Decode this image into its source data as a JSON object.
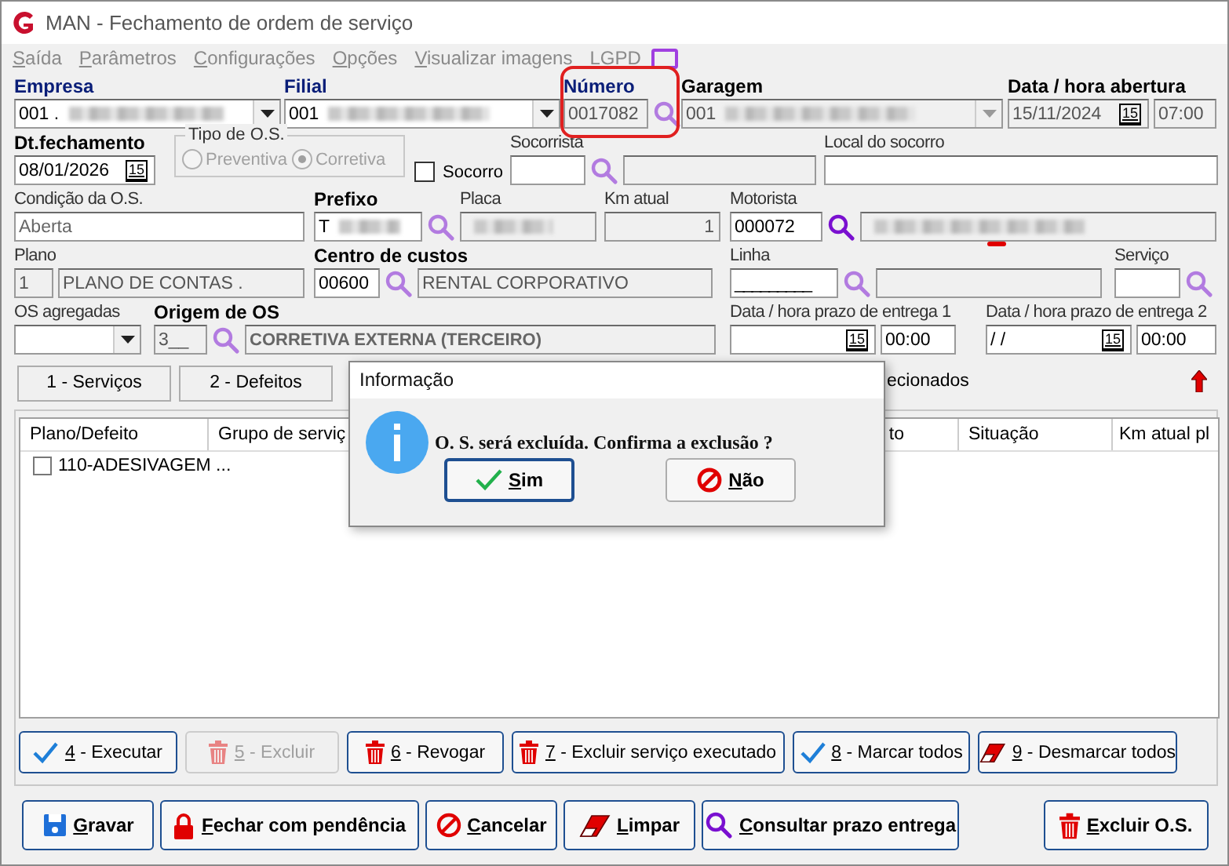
{
  "window": {
    "title": "MAN - Fechamento de ordem de serviço"
  },
  "menu": [
    {
      "label": "Saída"
    },
    {
      "label": "Parâmetros"
    },
    {
      "label": "Configurações"
    },
    {
      "label": "Opções"
    },
    {
      "label": "Visualizar imagens"
    },
    {
      "label": "LGPD"
    }
  ],
  "rows": [
    [
      {
        "label": "Empresa",
        "controls": [
          {
            "kind": "combo",
            "value": "001 .",
            "blurred": true,
            "readonly": false
          }
        ]
      },
      {
        "label": "Filial",
        "controls": [
          {
            "kind": "combo",
            "value": "001",
            "blurred": true,
            "readonly": false
          }
        ]
      },
      {
        "label": "Número",
        "controls": [
          {
            "kind": "text",
            "value": "0017082",
            "readonly": true
          },
          {
            "kind": "search",
            "emphasized": false
          }
        ]
      },
      {
        "label": "Garagem",
        "controls": [
          {
            "kind": "combo",
            "value": "001",
            "blurred": true,
            "readonly": true
          }
        ]
      },
      {
        "label": "Data / hora abertura",
        "controls": [
          {
            "kind": "date",
            "value": "15/11/2024",
            "icon_text": "15",
            "readonly": true
          },
          {
            "kind": "text",
            "value": "07:00",
            "readonly": true
          }
        ]
      }
    ],
    [
      {
        "label": "Dt.fechamento",
        "controls": [
          {
            "kind": "date",
            "value": "08/01/2026",
            "icon_text": "15",
            "readonly": false
          }
        ]
      },
      {
        "kind": "radio-group",
        "label": "Tipo de O.S.",
        "disabled": true,
        "options": [
          {
            "label": "Preventiva",
            "selected": false
          },
          {
            "label": "Corretiva",
            "selected": true
          }
        ]
      },
      {
        "kind": "checkbox",
        "label": "Socorro",
        "checked": false
      },
      {
        "label": "Socorrista",
        "controls": [
          {
            "kind": "text",
            "readonly": false
          },
          {
            "kind": "search",
            "emphasized": false
          },
          {
            "kind": "text",
            "readonly": true
          }
        ]
      },
      {
        "label": "Local do socorro",
        "controls": [
          {
            "kind": "text",
            "readonly": false
          }
        ]
      }
    ],
    [
      {
        "label": "Condição da O.S.",
        "controls": [
          {
            "kind": "text",
            "value": "Aberta",
            "readonly": false
          }
        ]
      },
      {
        "label": "Prefixo",
        "controls": [
          {
            "kind": "text",
            "value": "T",
            "blurred": true,
            "readonly": false
          },
          {
            "kind": "search",
            "emphasized": false
          }
        ]
      },
      {
        "label": "Placa",
        "controls": [
          {
            "kind": "text",
            "blurred": true,
            "readonly": true
          }
        ]
      },
      {
        "label": "Km atual",
        "controls": [
          {
            "kind": "number",
            "value": "1",
            "readonly": true
          }
        ]
      },
      {
        "label": "Motorista",
        "controls": [
          {
            "kind": "text",
            "value": "000072",
            "readonly": false
          },
          {
            "kind": "search",
            "emphasized": true
          },
          {
            "kind": "text",
            "blurred": true,
            "readonly": true
          }
        ]
      }
    ],
    [
      {
        "label": "Plano",
        "controls": [
          {
            "kind": "text",
            "value": "1",
            "readonly": true
          },
          {
            "kind": "text",
            "value": "PLANO DE CONTAS .",
            "readonly": true
          }
        ]
      },
      {
        "label": "Centro de custos",
        "controls": [
          {
            "kind": "text",
            "value": "00600",
            "readonly": false
          },
          {
            "kind": "search",
            "emphasized": false
          },
          {
            "kind": "text",
            "value": "RENTAL CORPORATIVO",
            "readonly": true
          }
        ]
      },
      {
        "label": "Linha",
        "controls": [
          {
            "kind": "text",
            "value": "_________",
            "readonly": false
          },
          {
            "kind": "search",
            "emphasized": false
          },
          {
            "kind": "text",
            "readonly": true
          }
        ]
      },
      {
        "label": "Serviço",
        "controls": [
          {
            "kind": "text",
            "readonly": false
          },
          {
            "kind": "search",
            "emphasized": false
          }
        ]
      }
    ],
    [
      {
        "label": "OS agregadas",
        "controls": [
          {
            "kind": "combo",
            "readonly": false
          }
        ]
      },
      {
        "label": "Origem de OS",
        "controls": [
          {
            "kind": "text",
            "value": "3__",
            "readonly": true
          },
          {
            "kind": "search",
            "emphasized": false
          },
          {
            "kind": "text",
            "value": "CORRETIVA EXTERNA (TERCEIRO)",
            "readonly": true
          }
        ]
      },
      {
        "label": "Data / hora prazo de entrega 1",
        "controls": [
          {
            "kind": "date",
            "icon_text": "15",
            "readonly": false
          },
          {
            "kind": "text",
            "value": "00:00",
            "readonly": false
          }
        ]
      },
      {
        "label": "Data / hora prazo de entrega 2",
        "controls": [
          {
            "kind": "date",
            "value": "/  /",
            "icon_text": "15",
            "readonly": false
          },
          {
            "kind": "text",
            "value": "00:00",
            "readonly": false
          }
        ]
      }
    ]
  ],
  "section_buttons": [
    {
      "label": "1 - Serviços"
    },
    {
      "label": "2 - Defeitos"
    }
  ],
  "selected_note": "ecionados",
  "table": {
    "columns": [
      "Plano/Defeito",
      "Grupo de serviç",
      "to",
      "Situação",
      "Km atual pl"
    ],
    "rows": [
      {
        "checked": false,
        "cells": [
          "110-ADESIVAGEM ..."
        ]
      }
    ]
  },
  "action_buttons": [
    {
      "label": "4 - Executar",
      "kind": "check",
      "disabled": false
    },
    {
      "label": "5 - Excluir",
      "kind": "trash",
      "disabled": true
    },
    {
      "label": "6 - Revogar",
      "kind": "trash",
      "disabled": false
    },
    {
      "label": "7 - Excluir serviço executado",
      "kind": "trash",
      "disabled": false
    },
    {
      "label": "8 - Marcar todos",
      "kind": "check",
      "disabled": false
    },
    {
      "label": "9 - Desmarcar todos",
      "kind": "eraser",
      "disabled": false
    }
  ],
  "footer_buttons": [
    {
      "label": "Gravar",
      "kind": "save"
    },
    {
      "label": "Fechar com pendência",
      "kind": "lock"
    },
    {
      "label": "Cancelar",
      "kind": "cancel"
    },
    {
      "label": "Limpar",
      "kind": "eraser"
    },
    {
      "label": "Consultar prazo entrega",
      "kind": "search"
    },
    {
      "label": "Excluir O.S.",
      "kind": "trash"
    }
  ],
  "dialog": {
    "title": "Informação",
    "message": "O. S. será excluída. Confirma a exclusão ?",
    "buttons": [
      {
        "label": "Sim",
        "kind": "check",
        "focused": true
      },
      {
        "label": "Não",
        "kind": "cancel",
        "focused": false
      }
    ]
  }
}
